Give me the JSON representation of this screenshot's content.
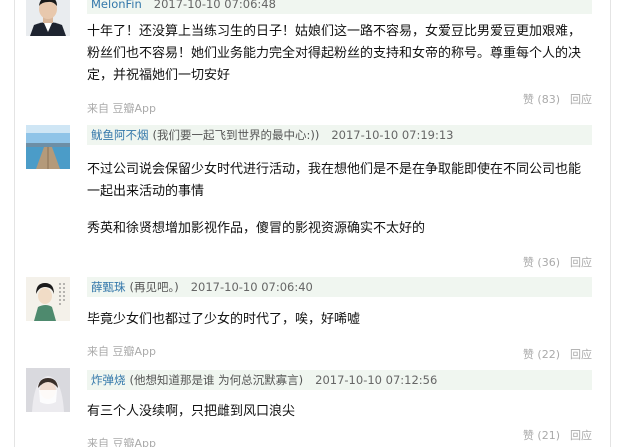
{
  "comments": [
    {
      "username": "MelonFin",
      "signature": "",
      "time": "2017-10-10 07:06:48",
      "body": [
        "十年了！还没算上当练习生的日子！姑娘们这一路不容易，女爱豆比男爱豆更加艰难，粉丝们也不容易！她们业务能力完全对得起粉丝的支持和女帝的称号。尊重每个人的决定，并祝福她们一切安好"
      ],
      "source_prefix": "来自",
      "source_app": "豆瓣App",
      "like_label": "赞",
      "like_count": "(83)",
      "reply_label": "回应"
    },
    {
      "username": "鱿鱼阿不烟",
      "signature": "(我们要一起飞到世界的最中心:))",
      "time": "2017-10-10 07:19:13",
      "body": [
        "不过公司说会保留少女时代进行活动，我在想他们是不是在争取能即使在不同公司也能一起出来活动的事情",
        "秀英和徐贤想增加影视作品，傻冒的影视资源确实不太好的"
      ],
      "source_prefix": "",
      "source_app": "",
      "like_label": "赞",
      "like_count": "(36)",
      "reply_label": "回应"
    },
    {
      "username": "薛甄珠",
      "signature": "(再见吧。)",
      "time": "2017-10-10 07:06:40",
      "body": [
        "毕竟少女们也都过了少女的时代了，唉，好唏嘘"
      ],
      "source_prefix": "来自",
      "source_app": "豆瓣App",
      "like_label": "赞",
      "like_count": "(22)",
      "reply_label": "回应"
    },
    {
      "username": "炸弹烧",
      "signature": "(他想知道那是谁 为何总沉默寡言)",
      "time": "2017-10-10 07:12:56",
      "body": [
        "有三个人没续啊，只把雌到风口浪尖"
      ],
      "source_prefix": "来自",
      "source_app": "豆瓣App",
      "like_label": "赞",
      "like_count": "(21)",
      "reply_label": "回应"
    }
  ],
  "avatars": [
    "avatar-man-suit-icon",
    "avatar-pier-lake-icon",
    "avatar-traditional-portrait-icon",
    "avatar-woman-veil-icon"
  ],
  "colors": {
    "username": "#3377aa",
    "meta_background": "#f0f6f0",
    "muted": "#aaaaaa",
    "body_text": "#111111"
  }
}
